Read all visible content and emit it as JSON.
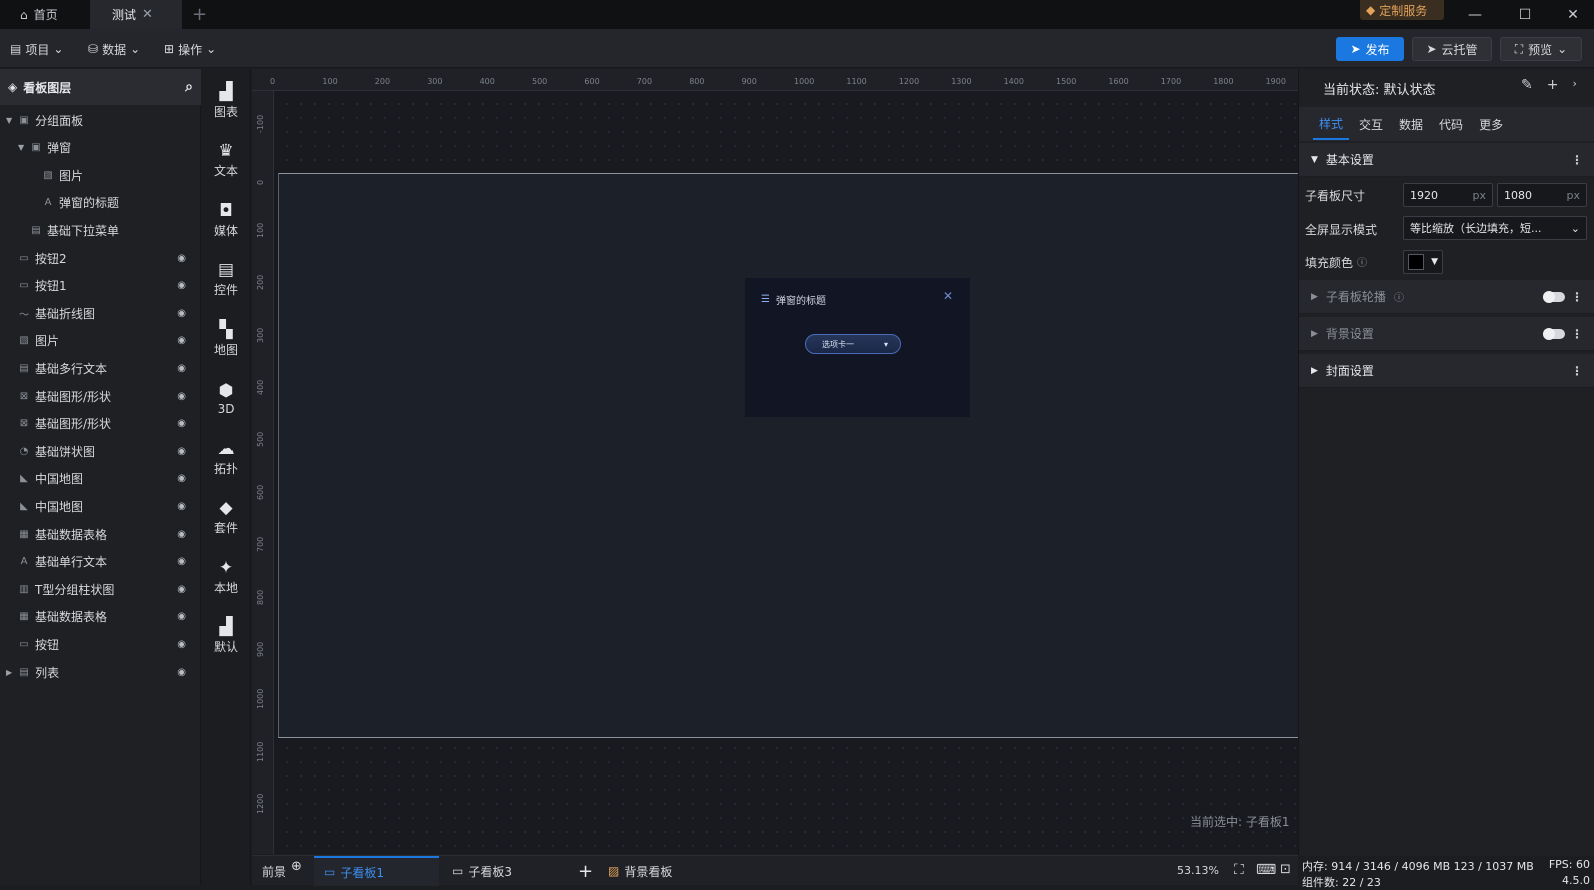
{
  "titlebar": {
    "tabs": [
      {
        "label": "首页"
      },
      {
        "label": "测试"
      }
    ],
    "custom_service": "定制服务"
  },
  "menubar": {
    "project": "项目",
    "data": "数据",
    "operation": "操作",
    "publish": "发布",
    "cloud": "云托管",
    "preview": "预览"
  },
  "layers": {
    "title": "看板图层",
    "items": [
      {
        "label": "分组面板"
      },
      {
        "label": "弹窗"
      },
      {
        "label": "图片"
      },
      {
        "label": "弹窗的标题"
      },
      {
        "label": "基础下拉菜单"
      },
      {
        "label": "按钮2"
      },
      {
        "label": "按钮1"
      },
      {
        "label": "基础折线图"
      },
      {
        "label": "图片"
      },
      {
        "label": "基础多行文本"
      },
      {
        "label": "基础图形/形状"
      },
      {
        "label": "基础图形/形状"
      },
      {
        "label": "基础饼状图"
      },
      {
        "label": "中国地图"
      },
      {
        "label": "中国地图"
      },
      {
        "label": "基础数据表格"
      },
      {
        "label": "基础单行文本"
      },
      {
        "label": "T型分组柱状图"
      },
      {
        "label": "基础数据表格"
      },
      {
        "label": "按钮"
      },
      {
        "label": "列表"
      }
    ]
  },
  "toolbox": [
    {
      "label": "图表"
    },
    {
      "label": "文本"
    },
    {
      "label": "媒体"
    },
    {
      "label": "控件"
    },
    {
      "label": "地图"
    },
    {
      "label": "3D"
    },
    {
      "label": "拓扑"
    },
    {
      "label": "套件"
    },
    {
      "label": "本地"
    },
    {
      "label": "默认"
    }
  ],
  "ruler": {
    "top": [
      "0",
      "100",
      "200",
      "300",
      "400",
      "500",
      "600",
      "700",
      "800",
      "900",
      "1000",
      "1100",
      "1200",
      "1300",
      "1400",
      "1500",
      "1600",
      "1700",
      "1800",
      "1900"
    ],
    "left": [
      "-100",
      "0",
      "100",
      "200",
      "300",
      "400",
      "500",
      "600",
      "700",
      "800",
      "900",
      "1000",
      "1100",
      "1200"
    ]
  },
  "canvas": {
    "popup_title": "弹窗的标题",
    "dropdown_value": "选项卡一",
    "current_selection": "当前选中: 子看板1"
  },
  "bottombar": {
    "foreground": "前景",
    "tabs": [
      {
        "label": "子看板1"
      },
      {
        "label": "子看板3"
      }
    ],
    "background_board": "背景看板",
    "zoom": "53.13%"
  },
  "props": {
    "state": "当前状态: 默认状态",
    "tabs": [
      {
        "label": "样式"
      },
      {
        "label": "交互"
      },
      {
        "label": "数据"
      },
      {
        "label": "代码"
      },
      {
        "label": "更多"
      }
    ],
    "basic_settings": "基本设置",
    "size_label": "子看板尺寸",
    "width": "1920",
    "height": "1080",
    "unit": "px",
    "fullscreen_label": "全屏显示模式",
    "fullscreen_value": "等比缩放（长边填充，短...",
    "fill_label": "填充颜色",
    "fill_color": "#000000",
    "carousel": "子看板轮播",
    "background": "背景设置",
    "cover": "封面设置"
  },
  "status": {
    "memory": "内存: 914 / 3146 / 4096 MB 123 / 1037 MB",
    "fps": "FPS: 60",
    "components": "组件数: 22 / 23",
    "version": "4.5.0"
  }
}
